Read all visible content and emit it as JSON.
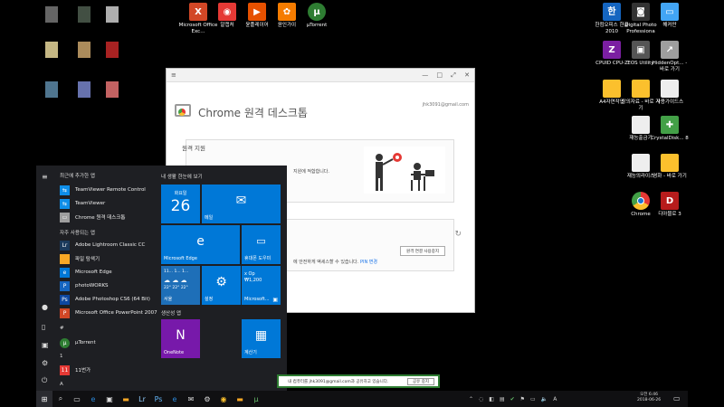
{
  "desktop": {
    "top_icons": [
      {
        "label": "Microsoft Office Exc...",
        "icon": "office-icon",
        "color": "#d24726"
      },
      {
        "label": "알캡처",
        "icon": "alcapture-icon",
        "color": "#e53935"
      },
      {
        "label": "윤플레이어",
        "icon": "player-icon",
        "color": "#e65100"
      },
      {
        "label": "윤인가이",
        "icon": "film-icon",
        "color": "#f57c00"
      },
      {
        "label": "μTorrent",
        "icon": "utorrent-icon",
        "color": "#2e7d32"
      }
    ],
    "right_icons": [
      {
        "label": "한컴오피스 한글 2010",
        "icon": "hwp-icon",
        "color": "#1565c0"
      },
      {
        "label": "Digital Photo Professiona",
        "icon": "camera-icon",
        "color": "#333333"
      },
      {
        "label": "해커만",
        "icon": "app-icon",
        "color": "#42a5f5"
      },
      {
        "label": "CPUID CPU-Z",
        "icon": "cpuz-icon",
        "color": "#7b1fa2"
      },
      {
        "label": "EOS Utility",
        "icon": "eos-icon",
        "color": "#555555"
      },
      {
        "label": "HiddenOpt... - 바로 가기",
        "icon": "shortcut-icon",
        "color": "#9e9e9e"
      },
      {
        "label": "A4자연작업",
        "icon": "folder-icon",
        "color": "#fbc02d"
      },
      {
        "label": "상의자료 - 바로 가기",
        "icon": "folder-icon",
        "color": "#fbc02d"
      },
      {
        "label": "사용가이드스",
        "icon": "document-icon",
        "color": "#eeeeee"
      },
      {
        "label": "재능출금기",
        "icon": "document-icon",
        "color": "#eeeeee"
      },
      {
        "label": "CrystalDisk... 8",
        "icon": "crystal-icon",
        "color": "#43a047"
      },
      {
        "label": "재능의라이스",
        "icon": "document-icon",
        "color": "#eeeeee"
      },
      {
        "label": "영화 - 바로 가기",
        "icon": "folder-icon",
        "color": "#fbc02d"
      },
      {
        "label": "Chrome",
        "icon": "chrome-icon",
        "color": "#fbc02d"
      },
      {
        "label": "디아블로 3",
        "icon": "diablo-icon",
        "color": "#b71c1c"
      }
    ]
  },
  "remote_window": {
    "title": "Chrome 원격 데스크톱",
    "email": "jhk3091@gmail.com",
    "section1_title": "원격 지원",
    "section1_desc": "지원에 적합합니다.",
    "section2_desc": "에 안전하게 액세스할 수 있습니다.",
    "pin_link": "PIN 변경",
    "action_button": "원격 연결 사용중지",
    "refresh_icon": "refresh-icon"
  },
  "start_menu": {
    "recent_header": "최근에 추가한 앱",
    "recent_apps": [
      {
        "label": "TeamViewer Remote Control",
        "icon": "teamviewer-icon",
        "color": "#0e8ee9"
      },
      {
        "label": "TeamViewer",
        "icon": "teamviewer-icon",
        "color": "#0e8ee9"
      },
      {
        "label": "Chrome 원격 데스크톱",
        "icon": "remote-desktop-icon",
        "color": "#9e9e9e"
      }
    ],
    "frequent_header": "자주 사용되는 앱",
    "frequent_apps": [
      {
        "label": "Adobe Lightroom Classic CC",
        "icon": "lightroom-icon",
        "color": "#1b3a5c"
      },
      {
        "label": "파일 탐색기",
        "icon": "folder-icon",
        "color": "#f9a825"
      },
      {
        "label": "Microsoft Edge",
        "icon": "edge-icon",
        "color": "#0078d7"
      },
      {
        "label": "photoWORKS",
        "icon": "photoworks-icon",
        "color": "#1565c0"
      },
      {
        "label": "Adobe Photoshop CS6 (64 Bit)",
        "icon": "photoshop-icon",
        "color": "#0d47a1"
      },
      {
        "label": "Microsoft Office PowerPoint 2007",
        "icon": "powerpoint-icon",
        "color": "#d24726"
      }
    ],
    "hash_header": "#",
    "hash_apps": [
      {
        "label": "μTorrent",
        "icon": "utorrent-icon",
        "color": "#2e7d32"
      }
    ],
    "num_header": "1",
    "num_apps": [
      {
        "label": "11번가",
        "icon": "11st-icon",
        "color": "#e53935"
      }
    ],
    "a_header": "A",
    "tiles_header": "내 생활 한눈에 보기",
    "tiles": {
      "calendar_day": "화요일",
      "calendar_date": "26",
      "mail": "메일",
      "edge": "Microsoft Edge",
      "phone": "휴대폰 도우미",
      "weather": "서울",
      "weather_top": "11...  1...  1...",
      "weather_temps": "22°  22°  22°",
      "settings": "설정",
      "store": "Microsoft...",
      "store_price_top": "x Op",
      "store_price": "₩1,200",
      "productivity_header": "생산성 앱",
      "onenote": "OneNote",
      "calculator": "계산기"
    },
    "rail": [
      "hamburger-icon",
      "user-icon",
      "document-icon",
      "pictures-icon",
      "settings-icon",
      "power-icon"
    ]
  },
  "taskbar": {
    "pinned": [
      "start-icon",
      "search-icon",
      "taskview-icon",
      "edge-icon",
      "store-icon",
      "explorer-icon",
      "lightroom-icon",
      "photoshop-icon",
      "edge-icon",
      "mail-icon",
      "settings-icon",
      "chrome-icon",
      "folder-icon",
      "utorrent-icon"
    ],
    "tray": [
      "network-icon",
      "speaker-icon",
      "ime-icon"
    ],
    "time": "오전 6:46",
    "date": "2018-06-26",
    "ime_label": "A"
  },
  "notification": {
    "text": "내 컴퓨터를 jhk3091@gmail.com과 공유하고 있습니다.",
    "button": "공유 중지"
  }
}
